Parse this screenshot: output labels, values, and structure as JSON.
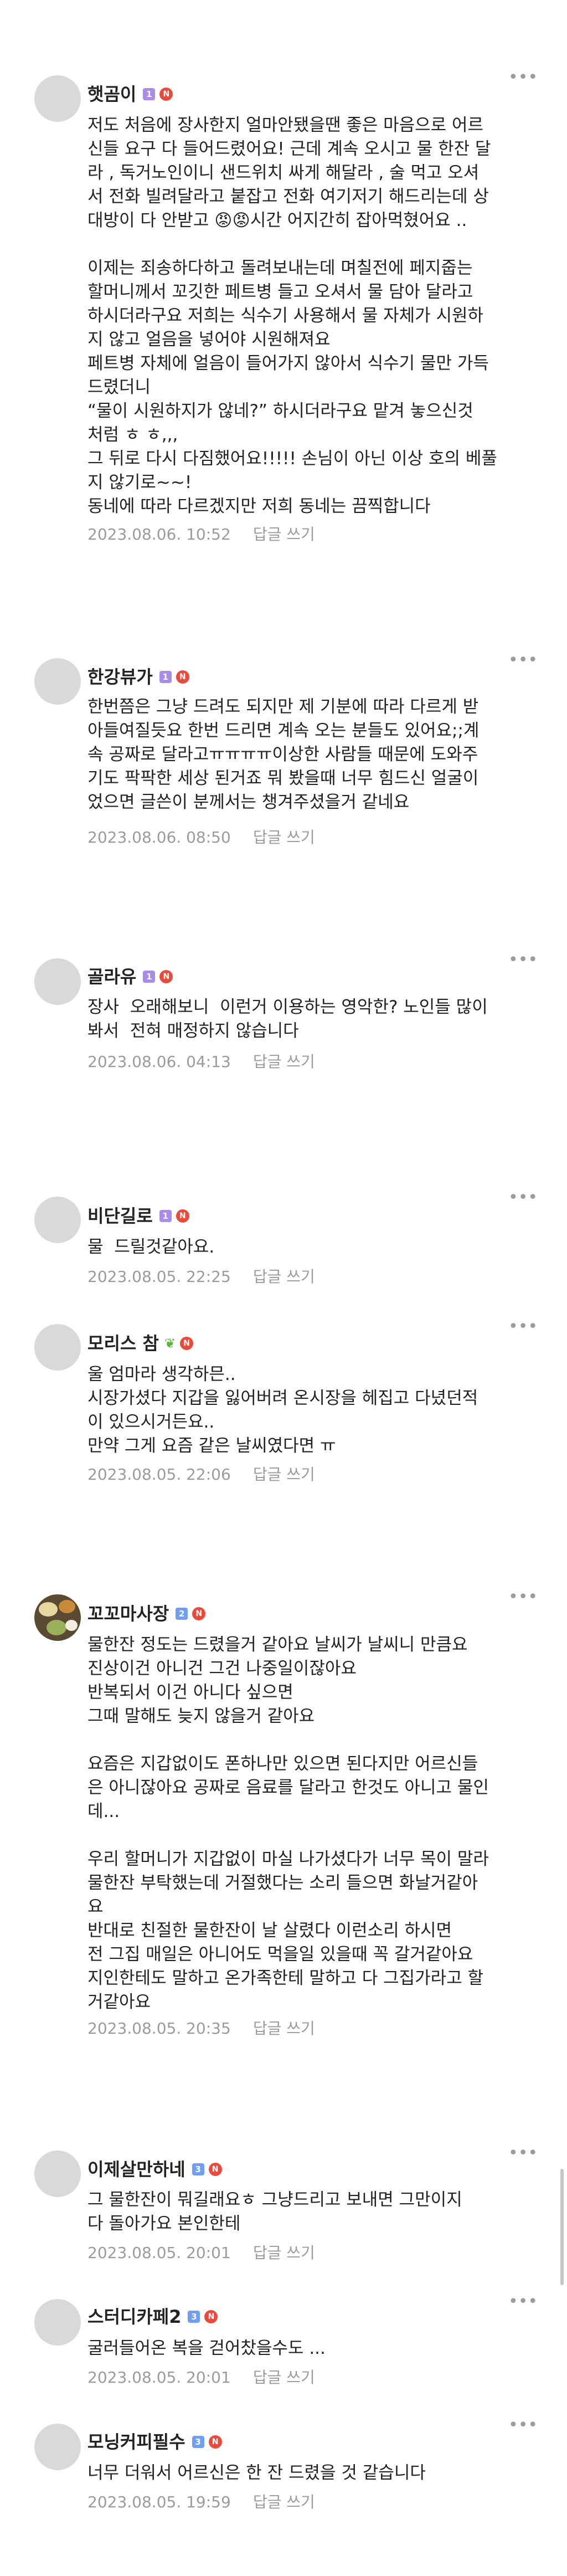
{
  "reply_label": "답글 쓰기",
  "colors": {
    "nickname": "#222222",
    "meta": "#9b9b9b",
    "new_badge": "#ea4a3b",
    "level_purple": "#a98be8",
    "level_blue": "#6f9ef2"
  },
  "comments": [
    {
      "nickname": "햇곰이",
      "level": "1",
      "lines": [
        "저도 처음에 장사한지 얼마안됐을땐 좋은 마음으로 어르",
        "신들 요구 다 들어드렸어요! 근데 계속 오시고 물 한잔 달",
        "라 , 독거노인이니 샌드위치 싸게 해달라 , 술 먹고 오셔",
        "서 전화 빌려달라고 붙잡고 전화 여기저기 해드리는데 상",
        "대방이 다 안받고 😡😡시간 어지간히 잡아먹혔어요 ..",
        "",
        "이제는 죄송하다하고 돌려보내는데 며칠전에 페지줍는",
        "할머니께서 꼬깃한 페트병 들고 오셔서 물 담아 달라고",
        "하시더라구요 저희는 식수기 사용해서 물 자체가 시원하",
        "지 않고 얼음을 넣어야 시원해져요",
        "페트병 자체에 얼음이 들어가지 않아서 식수기 물만 가득",
        "드렸더니",
        "“물이 시원하지가 않네?” 하시더라구요 맡겨 놓으신것",
        "처럼 ㅎ ㅎ,,,",
        "그 뒤로 다시 다짐했어요!!!!! 손님이 아닌 이상 호의 베풀",
        "지 않기로~~!",
        "동네에 따라 다르겠지만 저희 동네는 끔찍합니다"
      ],
      "date": "2023.08.06. 10:52"
    },
    {
      "nickname": "한강뷰가",
      "level": "1",
      "lines": [
        "한번쯤은 그냥 드려도 되지만 제 기분에 따라 다르게 받",
        "아들여질듯요 한번 드리면 계속 오는 분들도 있어요;;계",
        "속 공짜로 달라고ㅠㅠㅠㅠ이상한 사람들 때문에 도와주",
        "기도 팍팍한 세상 된거죠 뭐 봤을때 너무 힘드신 얼굴이",
        "었으면 글쓴이 분께서는 챙겨주셨을거 같네요"
      ],
      "date": "2023.08.06. 08:50"
    },
    {
      "nickname": "골라유",
      "level": "1",
      "lines": [
        "장사  오래해보니  이런거 이용하는 영악한? 노인들 많이",
        "봐서  전혀 매정하지 않습니다"
      ],
      "date": "2023.08.06. 04:13"
    },
    {
      "nickname": "비단길로",
      "level": "1",
      "lines": [
        "물  드릴것같아요."
      ],
      "date": "2023.08.05. 22:25"
    },
    {
      "nickname": "모리스 참",
      "lines": [
        "울 엄마라 생각하믄..",
        "시장가셨다 지갑을 잃어버려 온시장을 헤집고 다녔던적",
        "이 있으시거든요..",
        "만약 그게 요즘 같은 날씨였다면 ㅠ"
      ],
      "date": "2023.08.05. 22:06"
    },
    {
      "nickname": "꼬꼬마사장",
      "level": "2",
      "lines": [
        "물한잔 정도는 드렸을거 같아요 날씨가 날씨니 만큼요",
        "진상이건 아니건 그건 나중일이잖아요",
        "반복되서 이건 아니다 싶으면",
        "그때 말해도 늦지 않을거 같아요",
        "",
        "요즘은 지갑없이도 폰하나만 있으면 된다지만 어르신들",
        "은 아니잖아요 공짜로 음료를 달라고 한것도 아니고 물인",
        "데...",
        "",
        "우리 할머니가 지갑없이 마실 나가셨다가 너무 목이 말라",
        "물한잔 부탁했는데 거절했다는 소리 들으면 화날거같아",
        "요",
        "반대로 친절한 물한잔이 날 살렸다 이런소리 하시면",
        "전 그집 매일은 아니어도 먹을일 있을때 꼭 갈거같아요",
        "지인한테도 말하고 온가족한테 말하고 다 그집가라고 할",
        "거같아요"
      ],
      "date": "2023.08.05. 20:35"
    },
    {
      "nickname": "이제살만하네",
      "level": "3",
      "lines": [
        "그 물한잔이 뭐길래요ㅎ 그냥드리고 보내면 그만이지",
        "다 돌아가요 본인한테"
      ],
      "date": "2023.08.05. 20:01"
    },
    {
      "nickname": "스터디카페2",
      "level": "3",
      "lines": [
        "굴러들어온 복을 걷어찼을수도 ..."
      ],
      "date": "2023.08.05. 20:01"
    },
    {
      "nickname": "모닝커피필수",
      "level": "3",
      "lines": [
        "너무 더워서 어르신은 한 잔 드렸을 것 같습니다"
      ],
      "date": "2023.08.05. 19:59"
    }
  ]
}
